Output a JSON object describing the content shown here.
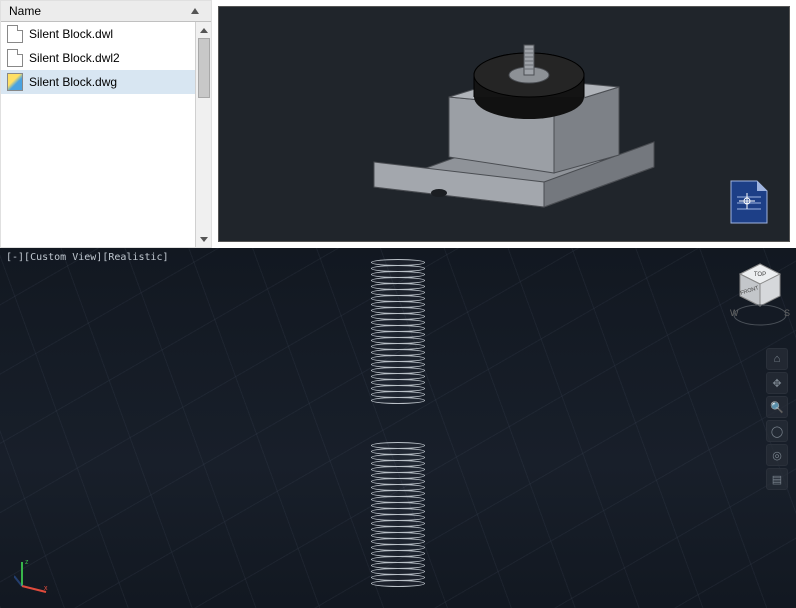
{
  "file_panel": {
    "header": "Name",
    "items": [
      {
        "label": "Silent  Block.dwl",
        "type": "generic",
        "selected": false
      },
      {
        "label": "Silent  Block.dwl2",
        "type": "generic",
        "selected": false
      },
      {
        "label": "Silent  Block.dwg",
        "type": "dwg",
        "selected": true
      }
    ]
  },
  "preview": {
    "file_icon_name": "dwg-file-icon"
  },
  "viewport": {
    "label": "[-][Custom View][Realistic]",
    "viewcube_top": "TOP",
    "viewcube_front": "FRONT",
    "compass_w": "W",
    "compass_s": "S",
    "nav_tools": [
      "home-icon",
      "pan-icon",
      "zoom-icon",
      "orbit-icon",
      "wheel-icon",
      "showmotion-icon"
    ]
  },
  "ucs": {
    "x": "x",
    "y": "y",
    "z": "z"
  }
}
